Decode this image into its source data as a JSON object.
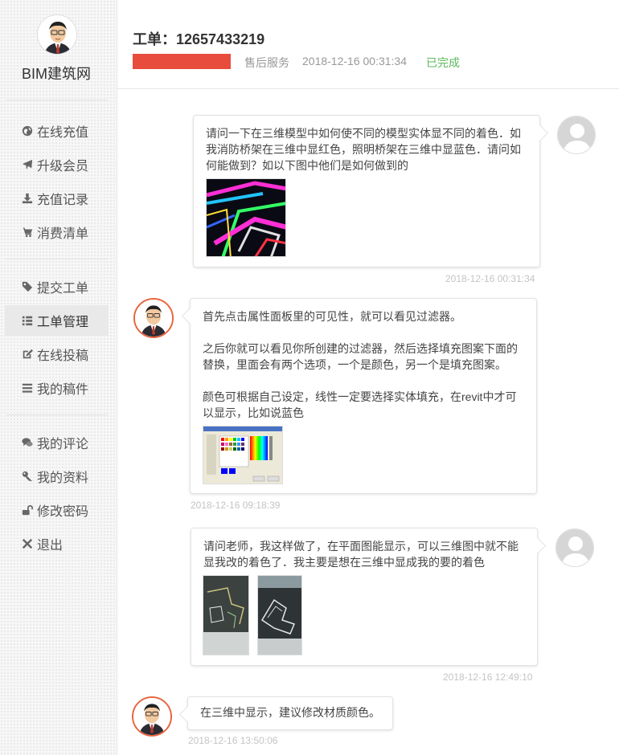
{
  "sidebar": {
    "brand_name": "BIM建筑网",
    "items": [
      {
        "label": "在线充值",
        "icon": "globe-icon"
      },
      {
        "label": "升级会员",
        "icon": "plane-icon"
      },
      {
        "label": "充值记录",
        "icon": "download-icon"
      },
      {
        "label": "消费清单",
        "icon": "cart-icon"
      },
      {
        "label": "提交工单",
        "icon": "tags-icon"
      },
      {
        "label": "工单管理",
        "icon": "list-icon",
        "active": true
      },
      {
        "label": "在线投稿",
        "icon": "edit-icon"
      },
      {
        "label": "我的稿件",
        "icon": "bars-icon"
      },
      {
        "label": "我的评论",
        "icon": "comments-icon"
      },
      {
        "label": "我的资料",
        "icon": "key-icon"
      },
      {
        "label": "修改密码",
        "icon": "unlock-icon"
      },
      {
        "label": "退出",
        "icon": "times-icon"
      }
    ]
  },
  "ticket": {
    "title": "工单：12657433219",
    "category": "售后服务",
    "datetime": "2018-12-16 00:31:34",
    "status": "已完成",
    "status_color": "#5cb85c",
    "accent_color": "#e84c3d"
  },
  "messages": [
    {
      "role": "user",
      "text": "请问一下在三维模型中如何使不同的模型实体显不同的着色．如我消防桥架在三维中显红色，照明桥架在三维中显蓝色．请问如何能做到？如以下图中他们是如何做到的",
      "time": "2018-12-16 00:31:34"
    },
    {
      "role": "staff",
      "paragraphs": [
        "首先点击属性面板里的可见性，就可以看见过滤器。",
        "之后你就可以看见你所创建的过滤器，然后选择填充图案下面的替换，里面会有两个选项，一个是颜色，另一个是填充图案。",
        "颜色可根据自己设定，线性一定要选择实体填充，在revit中才可以显示，比如说蓝色"
      ],
      "time": "2018-12-16 09:18:39"
    },
    {
      "role": "user",
      "text": "请问老师，我这样做了，在平面图能显示，可以三维图中就不能显我改的着色了．我主要是想在三维中显成我的要的着色",
      "time": "2018-12-16 12:49:10"
    },
    {
      "role": "staff",
      "text": "在三维中显示，建议修改材质颜色。",
      "time": "2018-12-16 13:50:06"
    }
  ]
}
